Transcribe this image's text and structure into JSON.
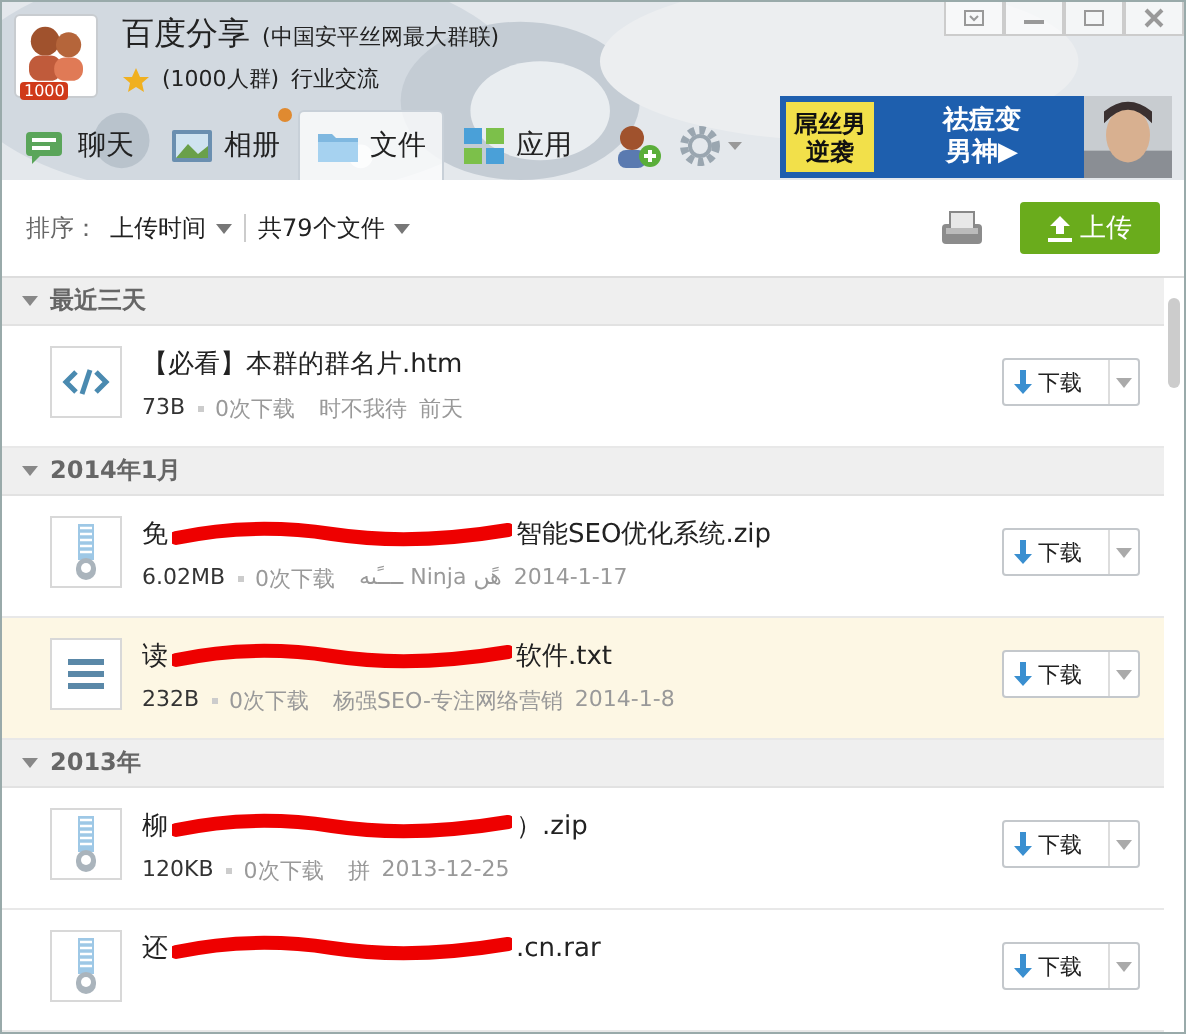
{
  "group": {
    "name": "百度分享",
    "subtitle": "(中国安平丝网最大群联)",
    "size": "(1000人群)",
    "category": "行业交流",
    "badge": "1000"
  },
  "tabs": [
    {
      "label": "聊天",
      "kind": "chat",
      "selected": false,
      "notice": false
    },
    {
      "label": "相册",
      "kind": "album",
      "selected": false,
      "notice": true
    },
    {
      "label": "文件",
      "kind": "folder",
      "selected": true,
      "notice": false
    },
    {
      "label": "应用",
      "kind": "apps",
      "selected": false,
      "notice": false
    }
  ],
  "ad": {
    "left": [
      "屌丝男",
      "逆袭"
    ],
    "right": [
      "祛痘变",
      "男神▶"
    ]
  },
  "toolbar": {
    "sort_label": "排序：",
    "sort_value": "上传时间",
    "count": "共79个文件",
    "upload": "上传"
  },
  "sections": [
    {
      "title": "最近三天",
      "files": [
        {
          "kind": "code",
          "title_start": "【必看】本群的群名片.htm",
          "size": "73B",
          "downloads": "0次下载",
          "uploader": "时不我待",
          "date": "前天",
          "redacted": false,
          "highlighted": false,
          "action": "下载"
        }
      ]
    },
    {
      "title": "2014年1月",
      "files": [
        {
          "kind": "zip",
          "title_start": "免",
          "title_end": "智能SEO优化系统.zip",
          "size": "6.02MB",
          "downloads": "0次下载",
          "uploader": "ــــًںه Ninja هًں",
          "date": "2014-1-17",
          "redacted": true,
          "highlighted": false,
          "action": "下载"
        },
        {
          "kind": "text",
          "title_start": "读",
          "title_end": "软件.txt",
          "size": "232B",
          "downloads": "0次下载",
          "uploader": "杨强SEO-专注网络营销",
          "date": "2014-1-8",
          "redacted": true,
          "highlighted": true,
          "action": "下载"
        }
      ]
    },
    {
      "title": "2013年",
      "files": [
        {
          "kind": "zip",
          "title_start": "柳",
          "title_end": "）.zip",
          "size": "120KB",
          "downloads": "0次下载",
          "uploader": "拼",
          "date": "2013-12-25",
          "redacted": true,
          "highlighted": false,
          "action": "下载"
        },
        {
          "kind": "zip",
          "title_start": "还",
          "title_end": ".cn.rar",
          "redacted": true,
          "highlighted": false,
          "action": "下载"
        }
      ]
    }
  ]
}
